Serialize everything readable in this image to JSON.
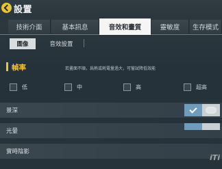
{
  "header": {
    "title": "設置"
  },
  "tabs": [
    {
      "label": "技術介面"
    },
    {
      "label": "基本訊息"
    },
    {
      "label": "音效和畫質"
    },
    {
      "label": "靈敏度"
    },
    {
      "label": "生存模式"
    }
  ],
  "subtabs": [
    {
      "label": "圖像"
    },
    {
      "label": "音效設置"
    }
  ],
  "frame_rate": {
    "title": "幀率",
    "note": "若畫面不順，爲熱或耗電量過大，可嘗試降低效能",
    "options": [
      {
        "label": "低"
      },
      {
        "label": "中"
      },
      {
        "label": "高"
      },
      {
        "label": "超高"
      }
    ]
  },
  "settings": [
    {
      "label": "景深",
      "enabled": true
    },
    {
      "label": "光暈",
      "enabled": true
    },
    {
      "label": "實時陰影",
      "enabled": false
    }
  ],
  "watermark": "iTi",
  "colors": {
    "accent": "#e9c43a",
    "toggle_on": "#6f9bbd"
  }
}
